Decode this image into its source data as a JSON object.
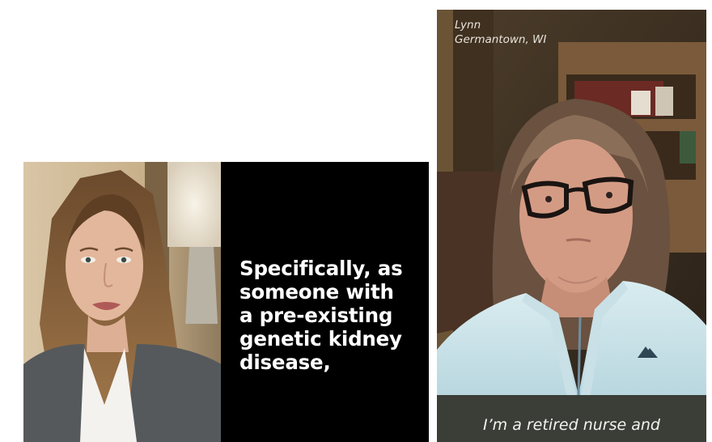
{
  "left_video": {
    "caption": "Specifically, as\nsomeone with\na pre-existing\ngenetic kidney\ndisease,"
  },
  "right_video": {
    "speaker_name": "Lynn",
    "speaker_location": "Germantown, WI",
    "caption": "I’m a retired nurse and"
  }
}
